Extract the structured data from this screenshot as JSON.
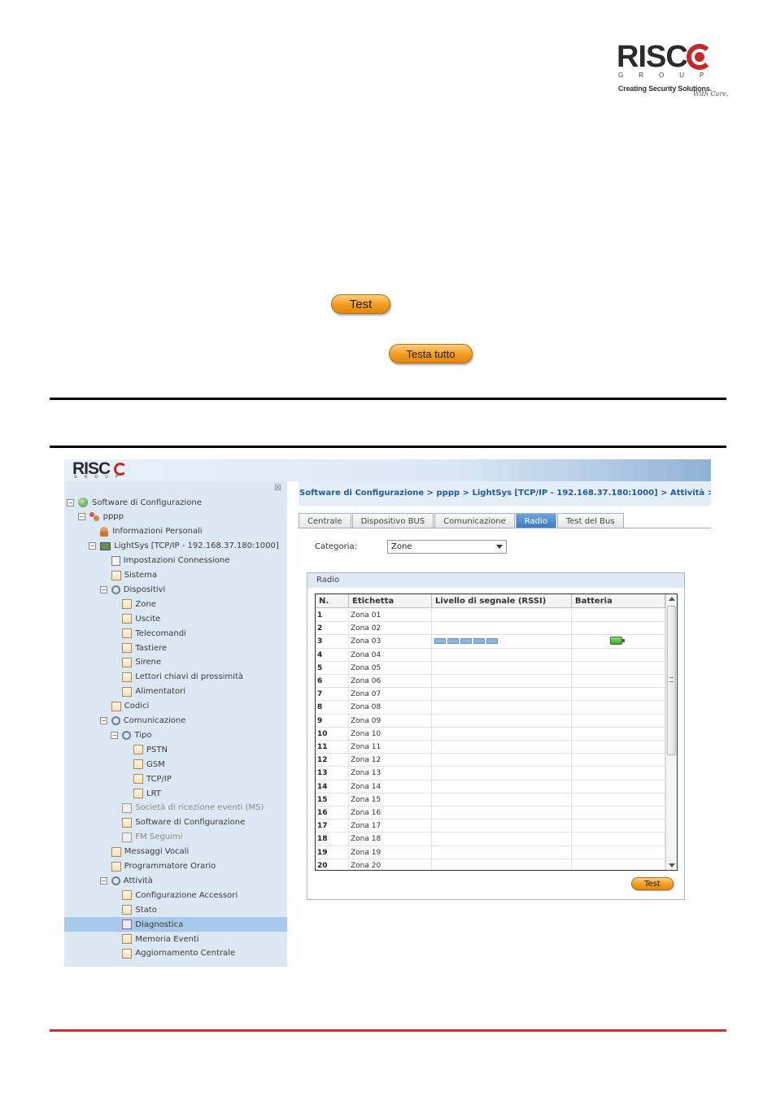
{
  "logo": {
    "brand": "RISC",
    "group": "GROUP",
    "slogan": "Creating Security Solutions.",
    "care": "With Care."
  },
  "doc": {
    "test_button": "Test",
    "test_all_button": "Testa tutto"
  },
  "app": {
    "logo": "RISC",
    "logo_group": "GROUP",
    "close_glyph": "☒",
    "tree": [
      {
        "label": "Software di Configurazione",
        "icon": "globe-icon",
        "level": 0,
        "expander": "−"
      },
      {
        "label": "pppp",
        "icon": "people-icon",
        "level": 1,
        "expander": "−"
      },
      {
        "label": "Informazioni Personali",
        "icon": "person-icon",
        "level": 2
      },
      {
        "label": "LightSys [TCP/IP - 192.168.37.180:1000]",
        "icon": "panel-icon",
        "level": 2,
        "expander": "−"
      },
      {
        "label": "Impostazioni Connessione",
        "icon": "connection-icon",
        "level": 3
      },
      {
        "label": "Sistema",
        "icon": "folder-icon",
        "level": 3
      },
      {
        "label": "Dispositivi",
        "icon": "gear-icon",
        "level": 3,
        "expander": "−"
      },
      {
        "label": "Zone",
        "icon": "folder-icon",
        "level": 4
      },
      {
        "label": "Uscite",
        "icon": "folder-icon",
        "level": 4
      },
      {
        "label": "Telecomandi",
        "icon": "folder-icon",
        "level": 4
      },
      {
        "label": "Tastiere",
        "icon": "folder-icon",
        "level": 4
      },
      {
        "label": "Sirene",
        "icon": "folder-icon",
        "level": 4
      },
      {
        "label": "Lettori chiavi di prossimità",
        "icon": "folder-icon",
        "level": 4
      },
      {
        "label": "Alimentatori",
        "icon": "folder-icon",
        "level": 4
      },
      {
        "label": "Codici",
        "icon": "folder-icon",
        "level": 3
      },
      {
        "label": "Comunicazione",
        "icon": "gear-icon",
        "level": 3,
        "expander": "−"
      },
      {
        "label": "Tipo",
        "icon": "gear-icon",
        "level": 4,
        "expander": "−"
      },
      {
        "label": "PSTN",
        "icon": "folder-icon",
        "level": 5
      },
      {
        "label": "GSM",
        "icon": "folder-icon",
        "level": 5
      },
      {
        "label": "TCP/IP",
        "icon": "folder-icon",
        "level": 5
      },
      {
        "label": "LRT",
        "icon": "folder-icon",
        "level": 5
      },
      {
        "label": "Società di ricezione eventi (MS)",
        "icon": "folder-icon",
        "level": 4,
        "disabled": true
      },
      {
        "label": "Software di Configurazione",
        "icon": "folder-icon",
        "level": 4
      },
      {
        "label": "FM Seguimi",
        "icon": "folder-icon",
        "level": 4,
        "disabled": true
      },
      {
        "label": "Messaggi Vocali",
        "icon": "folder-icon",
        "level": 3
      },
      {
        "label": "Programmatore Orario",
        "icon": "folder-icon",
        "level": 3
      },
      {
        "label": "Attività",
        "icon": "gear-icon",
        "level": 3,
        "expander": "−"
      },
      {
        "label": "Configurazione Accessori",
        "icon": "folder-icon",
        "level": 4
      },
      {
        "label": "Stato",
        "icon": "folder-icon",
        "level": 4
      },
      {
        "label": "Diagnostica",
        "icon": "diagnostics-icon",
        "level": 4,
        "selected": true
      },
      {
        "label": "Memoria Eventi",
        "icon": "folder-icon",
        "level": 4
      },
      {
        "label": "Aggiornamento Centrale",
        "icon": "folder-icon",
        "level": 4
      }
    ],
    "breadcrumb": "Software di Configurazione > pppp > LightSys [TCP/IP - 192.168.37.180:1000] > Attività > Diagnostica",
    "tabs": [
      "Centrale",
      "Dispositivo BUS",
      "Comunicazione",
      "Radio",
      "Test del Bus"
    ],
    "active_tab": "Radio",
    "category_label": "Categoria:",
    "category_value": "Zone",
    "radio_title": "Radio",
    "columns": [
      "N.",
      "Etichetta",
      "Livello di segnale (RSSI)",
      "Batteria"
    ],
    "rows": [
      {
        "n": "1",
        "label": "Zona 01"
      },
      {
        "n": "2",
        "label": "Zona 02"
      },
      {
        "n": "3",
        "label": "Zona 03",
        "rssi": 5,
        "battery": true
      },
      {
        "n": "4",
        "label": "Zona 04"
      },
      {
        "n": "5",
        "label": "Zona 05"
      },
      {
        "n": "6",
        "label": "Zona 06"
      },
      {
        "n": "7",
        "label": "Zona 07"
      },
      {
        "n": "8",
        "label": "Zona 08"
      },
      {
        "n": "9",
        "label": "Zona 09"
      },
      {
        "n": "10",
        "label": "Zona 10"
      },
      {
        "n": "11",
        "label": "Zona 11"
      },
      {
        "n": "12",
        "label": "Zona 12"
      },
      {
        "n": "13",
        "label": "Zona 13"
      },
      {
        "n": "14",
        "label": "Zona 14"
      },
      {
        "n": "15",
        "label": "Zona 15"
      },
      {
        "n": "16",
        "label": "Zona 16"
      },
      {
        "n": "17",
        "label": "Zona 17"
      },
      {
        "n": "18",
        "label": "Zona 18"
      },
      {
        "n": "19",
        "label": "Zona 19"
      },
      {
        "n": "20",
        "label": "Zona 20"
      }
    ],
    "test_button": "Test"
  }
}
